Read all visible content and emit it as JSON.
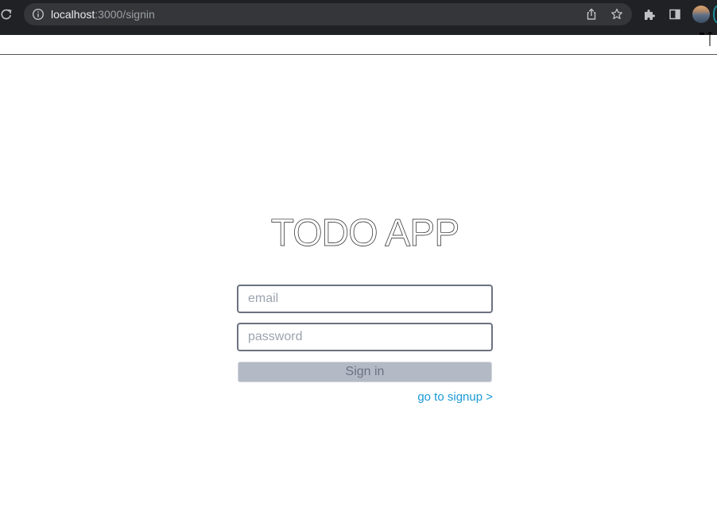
{
  "browser": {
    "url_host": "localhost",
    "url_path": ":3000/signin",
    "icons": [
      "reload-icon",
      "info-icon",
      "share-icon",
      "star-icon",
      "puzzle-extension-icon",
      "side-panel-icon",
      "profile-avatar"
    ]
  },
  "page": {
    "title": "TODO APP"
  },
  "form": {
    "email_placeholder": "email",
    "password_placeholder": "password",
    "signin_label": "Sign in",
    "signup_link": "go to signup >"
  },
  "colors": {
    "link": "#1a9ad6",
    "button_bg": "#b4bac5",
    "field_border": "#6b7280"
  }
}
